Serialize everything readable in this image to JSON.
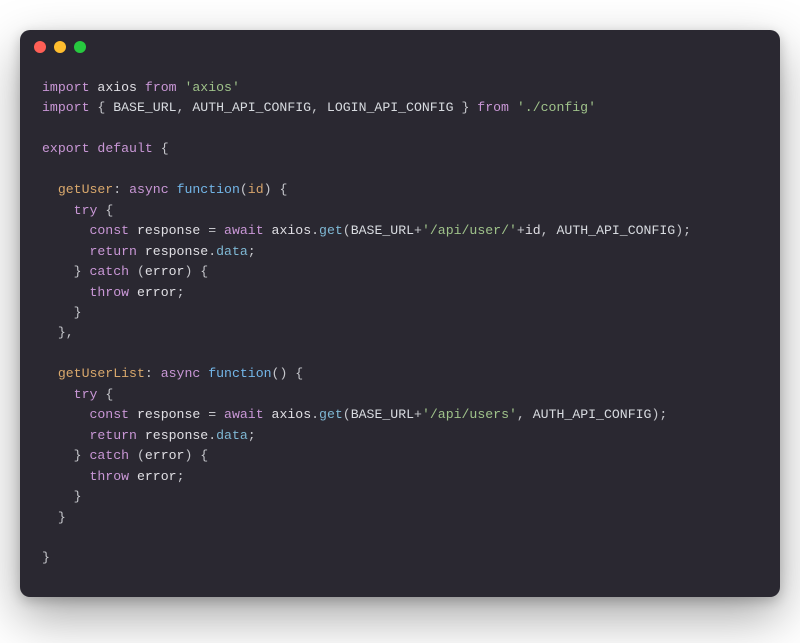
{
  "code": {
    "tokens": [
      [
        [
          "import",
          "kw"
        ],
        [
          " ",
          ""
        ],
        [
          "axios",
          "id"
        ],
        [
          " ",
          ""
        ],
        [
          "from",
          "kw"
        ],
        [
          " ",
          ""
        ],
        [
          "'axios'",
          "str"
        ]
      ],
      [
        [
          "import",
          "kw"
        ],
        [
          " { ",
          ""
        ],
        [
          "BASE_URL",
          "upper"
        ],
        [
          ", ",
          ""
        ],
        [
          "AUTH_API_CONFIG",
          "upper"
        ],
        [
          ", ",
          ""
        ],
        [
          "LOGIN_API_CONFIG",
          "upper"
        ],
        [
          " } ",
          ""
        ],
        [
          "from",
          "kw"
        ],
        [
          " ",
          ""
        ],
        [
          "'./config'",
          "str"
        ]
      ],
      [],
      [
        [
          "export",
          "kw"
        ],
        [
          " ",
          ""
        ],
        [
          "default",
          "kw"
        ],
        [
          " {",
          ""
        ]
      ],
      [],
      [
        [
          "  ",
          ""
        ],
        [
          "getUser",
          "method"
        ],
        [
          ": ",
          ""
        ],
        [
          "async",
          "kw"
        ],
        [
          " ",
          ""
        ],
        [
          "function",
          "fncolor"
        ],
        [
          "(",
          ""
        ],
        [
          "id",
          "param"
        ],
        [
          ") {",
          ""
        ]
      ],
      [
        [
          "    ",
          ""
        ],
        [
          "try",
          "kw"
        ],
        [
          " {",
          ""
        ]
      ],
      [
        [
          "      ",
          ""
        ],
        [
          "const",
          "kw"
        ],
        [
          " ",
          ""
        ],
        [
          "response",
          "id"
        ],
        [
          " = ",
          ""
        ],
        [
          "await",
          "kw2"
        ],
        [
          " ",
          ""
        ],
        [
          "axios",
          "id"
        ],
        [
          ".",
          ""
        ],
        [
          "get",
          "prop"
        ],
        [
          "(",
          ""
        ],
        [
          "BASE_URL",
          "upper"
        ],
        [
          "+",
          ""
        ],
        [
          "'/api/user/'",
          "str"
        ],
        [
          "+",
          ""
        ],
        [
          "id",
          "id"
        ],
        [
          ", ",
          ""
        ],
        [
          "AUTH_API_CONFIG",
          "upper"
        ],
        [
          ");",
          ""
        ]
      ],
      [
        [
          "      ",
          ""
        ],
        [
          "return",
          "kw"
        ],
        [
          " ",
          ""
        ],
        [
          "response",
          "id"
        ],
        [
          ".",
          ""
        ],
        [
          "data",
          "prop"
        ],
        [
          ";",
          ""
        ]
      ],
      [
        [
          "    } ",
          ""
        ],
        [
          "catch",
          "kw"
        ],
        [
          " (",
          ""
        ],
        [
          "error",
          "id"
        ],
        [
          ") {",
          ""
        ]
      ],
      [
        [
          "      ",
          ""
        ],
        [
          "throw",
          "kw"
        ],
        [
          " ",
          ""
        ],
        [
          "error",
          "id"
        ],
        [
          ";",
          ""
        ]
      ],
      [
        [
          "    }",
          ""
        ]
      ],
      [
        [
          "  },",
          ""
        ]
      ],
      [],
      [
        [
          "  ",
          ""
        ],
        [
          "getUserList",
          "method"
        ],
        [
          ": ",
          ""
        ],
        [
          "async",
          "kw"
        ],
        [
          " ",
          ""
        ],
        [
          "function",
          "fncolor"
        ],
        [
          "() {",
          ""
        ]
      ],
      [
        [
          "    ",
          ""
        ],
        [
          "try",
          "kw"
        ],
        [
          " {",
          ""
        ]
      ],
      [
        [
          "      ",
          ""
        ],
        [
          "const",
          "kw"
        ],
        [
          " ",
          ""
        ],
        [
          "response",
          "id"
        ],
        [
          " = ",
          ""
        ],
        [
          "await",
          "kw2"
        ],
        [
          " ",
          ""
        ],
        [
          "axios",
          "id"
        ],
        [
          ".",
          ""
        ],
        [
          "get",
          "prop"
        ],
        [
          "(",
          ""
        ],
        [
          "BASE_URL",
          "upper"
        ],
        [
          "+",
          ""
        ],
        [
          "'/api/users'",
          "str"
        ],
        [
          ", ",
          ""
        ],
        [
          "AUTH_API_CONFIG",
          "upper"
        ],
        [
          ");",
          ""
        ]
      ],
      [
        [
          "      ",
          ""
        ],
        [
          "return",
          "kw"
        ],
        [
          " ",
          ""
        ],
        [
          "response",
          "id"
        ],
        [
          ".",
          ""
        ],
        [
          "data",
          "prop"
        ],
        [
          ";",
          ""
        ]
      ],
      [
        [
          "    } ",
          ""
        ],
        [
          "catch",
          "kw"
        ],
        [
          " (",
          ""
        ],
        [
          "error",
          "id"
        ],
        [
          ") {",
          ""
        ]
      ],
      [
        [
          "      ",
          ""
        ],
        [
          "throw",
          "kw"
        ],
        [
          " ",
          ""
        ],
        [
          "error",
          "id"
        ],
        [
          ";",
          ""
        ]
      ],
      [
        [
          "    }",
          ""
        ]
      ],
      [
        [
          "  }",
          ""
        ]
      ],
      [],
      [
        [
          "}",
          ""
        ]
      ]
    ]
  }
}
